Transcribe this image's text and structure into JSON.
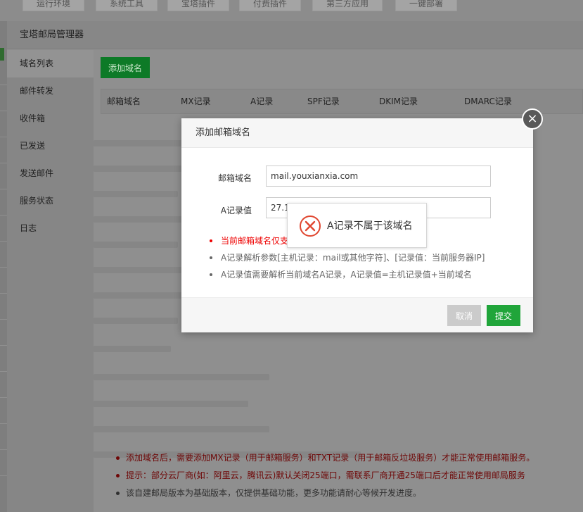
{
  "top_tabs": [
    "运行环境",
    "系统工具",
    "宝塔插件",
    "付费插件",
    "第三方应用",
    "一键部署"
  ],
  "window": {
    "title": "宝塔邮局管理器"
  },
  "sidebar": {
    "items": [
      {
        "label": "域名列表",
        "active": true
      },
      {
        "label": "邮件转发",
        "active": false
      },
      {
        "label": "收件箱",
        "active": false
      },
      {
        "label": "已发送",
        "active": false
      },
      {
        "label": "发送邮件",
        "active": false
      },
      {
        "label": "服务状态",
        "active": false
      },
      {
        "label": "日志",
        "active": false
      }
    ]
  },
  "main": {
    "add_domain_label": "添加域名",
    "table_headers": [
      "邮箱域名",
      "MX记录",
      "A记录",
      "SPF记录",
      "DKIM记录",
      "DMARC记录"
    ],
    "notes": [
      {
        "text": "添加域名后，需要添加MX记录（用于邮箱服务）和TXT记录（用于邮箱反垃圾服务）才能正常使用邮箱服务。",
        "tone": "red"
      },
      {
        "text": "提示：部分云厂商(如：阿里云，腾讯云)默认关闭25端口，需联系厂商开通25端口后才能正常使用邮局服务",
        "tone": "red"
      },
      {
        "text": "该自建邮局版本为基础版本，仅提供基础功能，更多功能请耐心等候开发进度。",
        "tone": "grey"
      }
    ]
  },
  "modal": {
    "title": "添加邮箱域名",
    "close_glyph": "×",
    "domain_label": "邮箱域名",
    "domain_value": "mail.youxianxia.com",
    "a_label": "A记录值",
    "a_value": "27.1",
    "tips": [
      {
        "text": "当前邮箱域名仅支",
        "tone": "red"
      },
      {
        "text": "A记录解析参数[主机记录：mail或其他字符]、[记录值：当前服务器IP]",
        "tone": "grey"
      },
      {
        "text": "A记录值需要解析当前域名A记录，A记录值=主机记录值+当前域名",
        "tone": "grey"
      }
    ],
    "cancel_label": "取消",
    "submit_label": "提交"
  },
  "toast": {
    "message": "A记录不属于该域名",
    "icon": "error-circle-x-icon"
  },
  "colors": {
    "accent_green": "#20a53a",
    "error_red": "#e00000",
    "toast_icon_red": "#e0462f"
  }
}
